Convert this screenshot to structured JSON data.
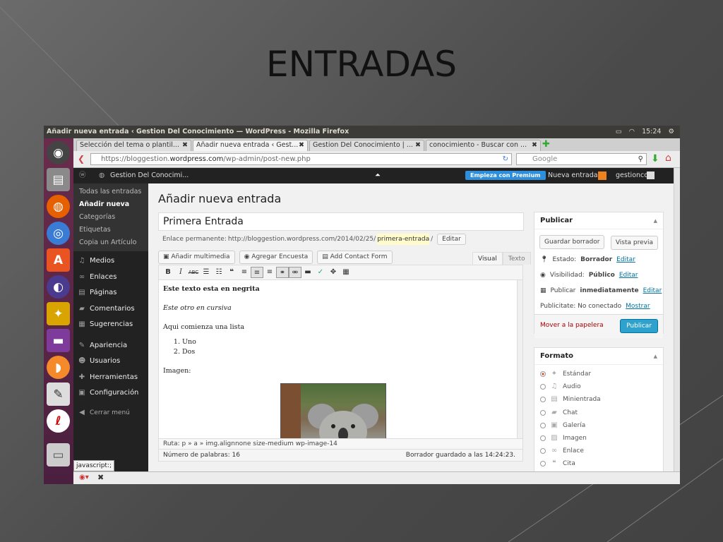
{
  "slide_title": "ENTRADAS",
  "window": {
    "title": "Añadir nueva entrada ‹ Gestion Del Conocimiento — WordPress - Mozilla Firefox",
    "time": "15:24"
  },
  "tabs": [
    {
      "label": "Selección del tema o plantil...",
      "close": "✖"
    },
    {
      "label": "Añadir nueva entrada ‹ Gest...",
      "close": "✖"
    },
    {
      "label": "Gestion Del Conocimiento | ...",
      "close": "✖"
    },
    {
      "label": "conocimiento - Buscar con ...",
      "close": "✖"
    }
  ],
  "nav": {
    "url_prefix": "https://bloggestion.",
    "url_domain": "wordpress.com",
    "url_suffix": "/wp-admin/post-new.php",
    "search_placeholder": "Google"
  },
  "adminbar": {
    "site": "Gestion Del Conocimi...",
    "premium": "Empieza con Premium",
    "new_post": "Nueva entrada",
    "user": "gestionco"
  },
  "sidebar": {
    "submenu": [
      "Todas las entradas",
      "Añadir nueva",
      "Categorías",
      "Etiquetas",
      "Copia un Artículo"
    ],
    "items": [
      "Medios",
      "Enlaces",
      "Páginas",
      "Comentarios",
      "Sugerencias",
      "Apariencia",
      "Usuarios",
      "Herramientas",
      "Configuración",
      "Cerrar menú"
    ]
  },
  "editor": {
    "heading": "Añadir nueva entrada",
    "post_title": "Primera Entrada",
    "permalink_label": "Enlace permanente:",
    "permalink_base": "http://bloggestion.wordpress.com/2014/02/25/",
    "permalink_slug": "primera-entrada",
    "permalink_end": "/",
    "edit_btn": "Editar",
    "media_buttons": [
      "Añadir multimedia",
      "Agregar Encuesta",
      "Add Contact Form"
    ],
    "tab_visual": "Visual",
    "tab_text": "Texto",
    "bold_line": "Este texto esta en negrita",
    "italic_line": "Este otro en cursiva",
    "list_intro": "Aqui comienza una lista",
    "list": [
      "Uno",
      "Dos"
    ],
    "image_label": "Imagen:",
    "path": "Ruta: p » a » img.alignnone size-medium wp-image-14",
    "word_count": "Número de palabras: 16",
    "saved": "Borrador guardado a las 14:24:23."
  },
  "publish": {
    "title": "Publicar",
    "save_draft": "Guardar borrador",
    "preview": "Vista previa",
    "status_label": "Estado:",
    "status_value": "Borrador",
    "visibility_label": "Visibilidad:",
    "visibility_value": "Público",
    "publish_label": "Publicar",
    "publish_value": "inmediatamente",
    "edit": "Editar",
    "publicize": "Publicitate: No conectado",
    "show": "Mostrar",
    "trash": "Mover a la papelera",
    "publish_btn": "Publicar"
  },
  "format": {
    "title": "Formato",
    "options": [
      "Estándar",
      "Audio",
      "Minientrada",
      "Chat",
      "Galería",
      "Imagen",
      "Enlace",
      "Cita"
    ]
  },
  "status": {
    "js": "javascript:;"
  }
}
